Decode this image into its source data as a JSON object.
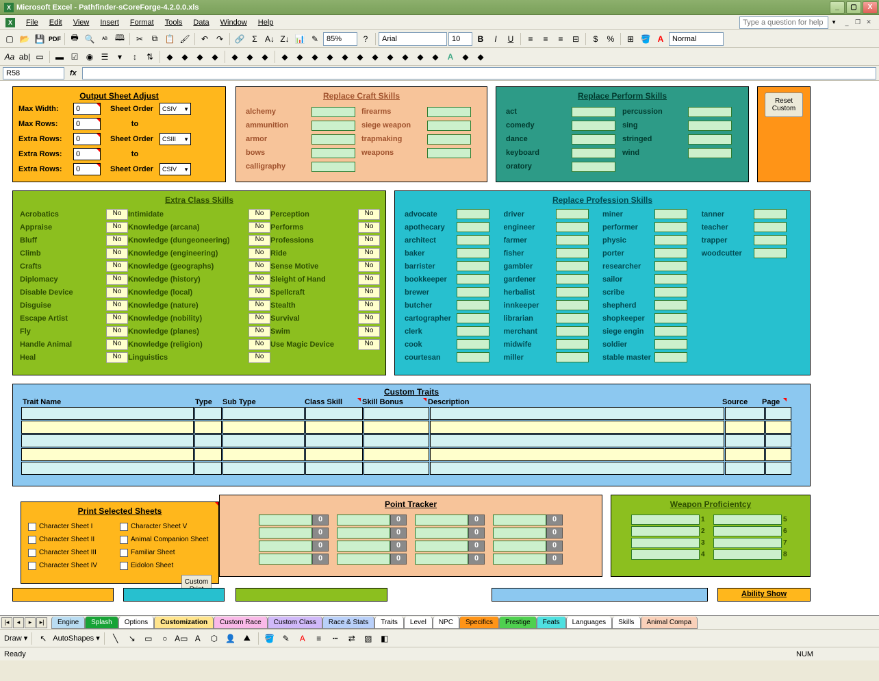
{
  "title": "Microsoft Excel - Pathfinder-sCoreForge-4.2.0.0.xls",
  "menus": [
    "File",
    "Edit",
    "View",
    "Insert",
    "Format",
    "Tools",
    "Data",
    "Window",
    "Help"
  ],
  "question_placeholder": "Type a question for help",
  "zoom": "85%",
  "font": "Arial",
  "fontsize": "10",
  "style": "Normal",
  "cellname": "R58",
  "output": {
    "title": "Output Sheet Adjust",
    "rows": [
      {
        "l": "Max Width:",
        "v": "0",
        "m": "Sheet Order",
        "c": "CSIV"
      },
      {
        "l": "Max Rows:",
        "v": "0",
        "m": "to",
        "c": ""
      },
      {
        "l": "Extra Rows:",
        "v": "0",
        "m": "Sheet Order",
        "c": "CSIII"
      },
      {
        "l": "Extra Rows:",
        "v": "0",
        "m": "to",
        "c": ""
      },
      {
        "l": "Extra Rows:",
        "v": "0",
        "m": "Sheet Order",
        "c": "CSIV"
      }
    ]
  },
  "craft": {
    "title": "Replace Craft Skills",
    "col1": [
      "alchemy",
      "ammunition",
      "armor",
      "bows",
      "calligraphy"
    ],
    "col2": [
      "firearms",
      "siege weapon",
      "trapmaking",
      "weapons"
    ]
  },
  "perform": {
    "title": "Replace Perform Skills",
    "col1": [
      "act",
      "comedy",
      "dance",
      "keyboard",
      "oratory"
    ],
    "col2": [
      "percussion",
      "sing",
      "stringed",
      "wind"
    ]
  },
  "reset": "Reset Custom",
  "extra": {
    "title": "Extra Class Skills",
    "c1": [
      "Acrobatics",
      "Appraise",
      "Bluff",
      "Climb",
      "Crafts",
      "Diplomacy",
      "Disable Device",
      "Disguise",
      "Escape Artist",
      "Fly",
      "Handle Animal",
      "Heal"
    ],
    "c2": [
      "Intimidate",
      "Knowledge (arcana)",
      "Knowledge (dungeoneering)",
      "Knowledge (engineering)",
      "Knowledge (geographs)",
      "Knowledge (history)",
      "Knowledge (local)",
      "Knowledge (nature)",
      "Knowledge (nobility)",
      "Knowledge (planes)",
      "Knowledge (religion)",
      "Linguistics"
    ],
    "c3": [
      "Perception",
      "Performs",
      "Professions",
      "Ride",
      "Sense Motive",
      "Sleight of Hand",
      "Spellcraft",
      "Stealth",
      "Survival",
      "Swim",
      "Use Magic Device"
    ],
    "no": "No"
  },
  "prof": {
    "title": "Replace Profession Skills",
    "c1": [
      "advocate",
      "apothecary",
      "architect",
      "baker",
      "barrister",
      "bookkeeper",
      "brewer",
      "butcher",
      "cartographer",
      "clerk",
      "cook",
      "courtesan"
    ],
    "c2": [
      "driver",
      "engineer",
      "farmer",
      "fisher",
      "gambler",
      "gardener",
      "herbalist",
      "innkeeper",
      "librarian",
      "merchant",
      "midwife",
      "miller"
    ],
    "c3": [
      "miner",
      "performer",
      "physic",
      "porter",
      "researcher",
      "sailor",
      "scribe",
      "shepherd",
      "shopkeeper",
      "siege engin",
      "soldier",
      "stable master"
    ],
    "c4": [
      "tanner",
      "teacher",
      "trapper",
      "woodcutter"
    ]
  },
  "traits": {
    "title": "Custom Traits",
    "hdr": [
      "Trait Name",
      "Type",
      "Sub Type",
      "Class Skill",
      "Skill Bonus",
      "Description",
      "Source",
      "Page"
    ]
  },
  "print": {
    "title": "Print Selected Sheets",
    "c1": [
      "Character Sheet I",
      "Character Sheet II",
      "Character Sheet III",
      "Character Sheet IV"
    ],
    "c2": [
      "Character Sheet V",
      "Animal Companion Sheet",
      "Familiar Sheet",
      "Eidolon Sheet"
    ],
    "btn": "Custom Print"
  },
  "tracker": {
    "title": "Point Tracker",
    "val": "0"
  },
  "weap": {
    "title": "Weapon Proficientcy",
    "nums1": [
      "1",
      "2",
      "3",
      "4"
    ],
    "nums2": [
      "5",
      "6",
      "7",
      "8"
    ]
  },
  "ability": "Ability Show",
  "tabs": [
    {
      "t": "Engine",
      "bg": "#b9dcf2"
    },
    {
      "t": "Splash",
      "bg": "#17a336",
      "c": "#fff"
    },
    {
      "t": "Options",
      "bg": "#fff"
    },
    {
      "t": "Customization",
      "bg": "#ffe48c",
      "b": true
    },
    {
      "t": "Custom Race",
      "bg": "#f9b9e8"
    },
    {
      "t": "Custom Class",
      "bg": "#d0b9f9"
    },
    {
      "t": "Race & Stats",
      "bg": "#b9d0f9"
    },
    {
      "t": "Traits",
      "bg": "#fff"
    },
    {
      "t": "Level",
      "bg": "#fff"
    },
    {
      "t": "NPC",
      "bg": "#fff"
    },
    {
      "t": "Specifics",
      "bg": "#ff9417"
    },
    {
      "t": "Prestige",
      "bg": "#4fd04f"
    },
    {
      "t": "Feats",
      "bg": "#4fe0e0"
    },
    {
      "t": "Languages",
      "bg": "#fff"
    },
    {
      "t": "Skills",
      "bg": "#fff"
    },
    {
      "t": "Animal Compa",
      "bg": "#f9d0b9"
    }
  ],
  "draw": {
    "draw": "Draw",
    "auto": "AutoShapes"
  },
  "status": {
    "ready": "Ready",
    "num": "NUM"
  }
}
